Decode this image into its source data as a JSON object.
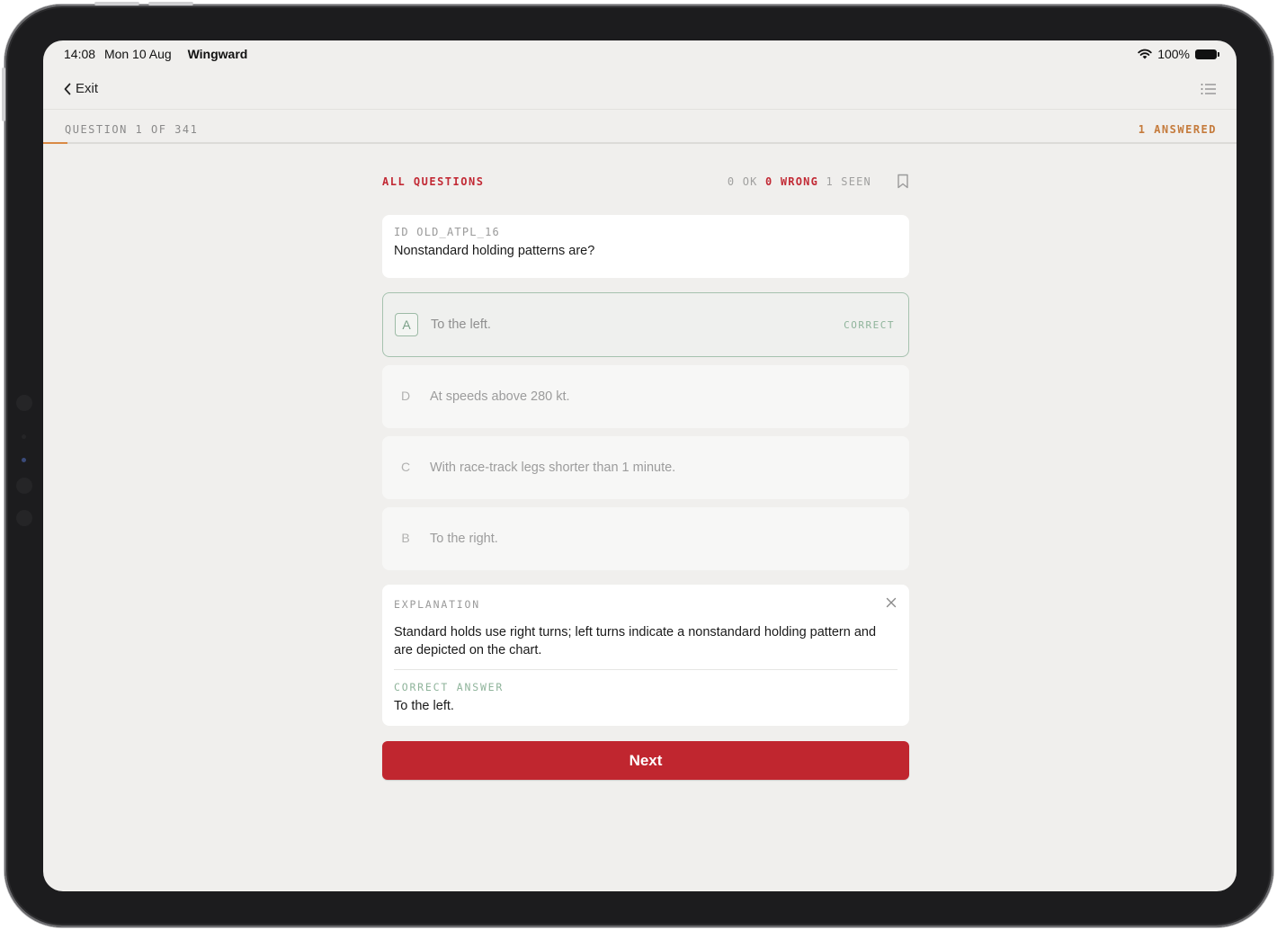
{
  "status_bar": {
    "time": "14:08",
    "date": "Mon 10 Aug",
    "app_name": "Wingward",
    "battery": "100%"
  },
  "nav": {
    "exit_label": "Exit",
    "menu_icon": "list-icon"
  },
  "progress": {
    "question_label": "QUESTION 1 OF 341",
    "answered_label": "1 ANSWERED",
    "fraction": 0.003,
    "accent": "#d98a45"
  },
  "quiz": {
    "filter_label": "ALL QUESTIONS",
    "stats": {
      "ok": "0 OK",
      "wrong": "0 WRONG",
      "seen": "1 SEEN"
    },
    "question": {
      "id_label": "ID OLD_ATPL_16",
      "text": "Nonstandard holding patterns are?"
    },
    "options": [
      {
        "letter": "A",
        "text": "To the left.",
        "badge": "CORRECT",
        "state": "correct"
      },
      {
        "letter": "D",
        "text": "At speeds above 280 kt.",
        "state": "dimmed"
      },
      {
        "letter": "C",
        "text": "With race-track legs shorter than 1 minute.",
        "state": "dimmed"
      },
      {
        "letter": "B",
        "text": "To the right.",
        "state": "dimmed"
      }
    ],
    "explanation": {
      "title": "EXPLANATION",
      "text": "Standard holds use right turns; left turns indicate a nonstandard holding pattern and are depicted on the chart.",
      "correct_answer_title": "CORRECT ANSWER",
      "correct_answer_text": "To the left."
    },
    "next_label": "Next"
  },
  "colors": {
    "brand_red": "#c0262f",
    "correct_green": "#8fb49b",
    "background": "#f0efed"
  }
}
